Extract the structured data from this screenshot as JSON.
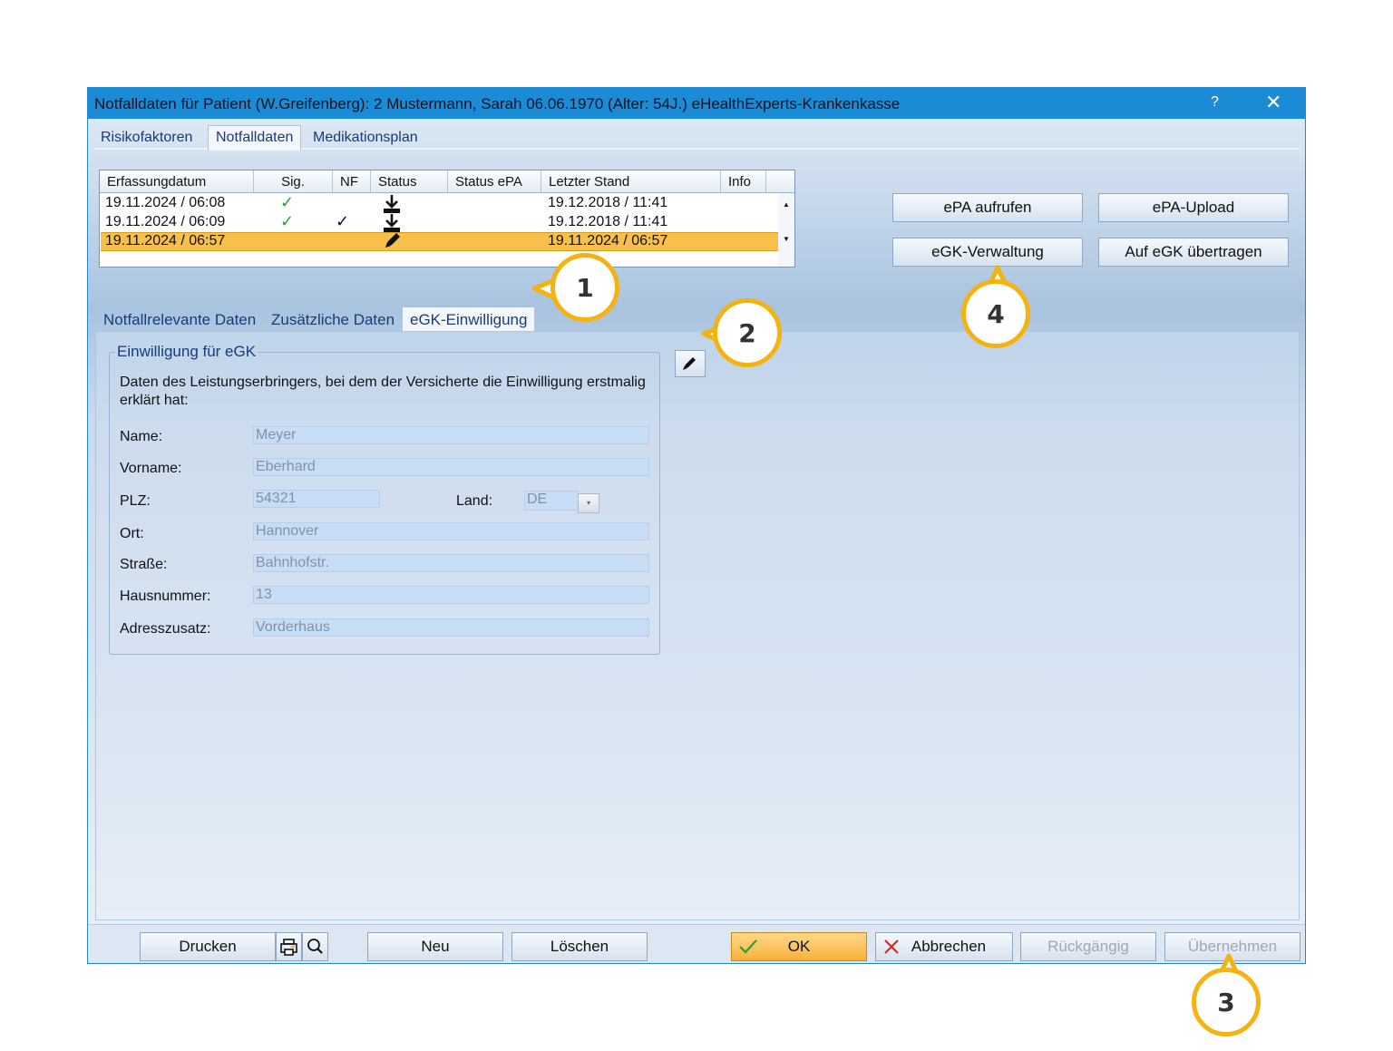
{
  "window": {
    "title": "Notfalldaten für Patient (W.Greifenberg): 2  Mustermann, Sarah 06.06.1970  (Alter: 54J.)  eHealthExperts-Krankenkasse",
    "help_label": "?",
    "close_label": "✕"
  },
  "top_tabs": [
    {
      "label": "Risikofaktoren"
    },
    {
      "label": "Notfalldaten"
    },
    {
      "label": "Medikationsplan"
    }
  ],
  "grid": {
    "columns": [
      "Erfassungdatum",
      "Sig.",
      "NF",
      "Status",
      "Status ePA",
      "Letzter Stand",
      "Info"
    ],
    "rows": [
      {
        "date": "19.11.2024 / 06:08",
        "sig": "✓",
        "nf": "",
        "status_icon": "download-icon",
        "status_epa": "",
        "last": "19.12.2018 / 11:41",
        "info": ""
      },
      {
        "date": "19.11.2024 / 06:09",
        "sig": "✓",
        "nf": "✓",
        "status_icon": "download-icon",
        "status_epa": "",
        "last": "19.12.2018 / 11:41",
        "info": ""
      },
      {
        "date": "19.11.2024 / 06:57",
        "sig": "",
        "nf": "",
        "status_icon": "pencil-icon",
        "status_epa": "",
        "last": "19.11.2024 / 06:57",
        "info": ""
      }
    ],
    "selected_row": 2,
    "selected_color": "#f7c04a"
  },
  "actions": {
    "epa_aufrufen": "ePA aufrufen",
    "epa_upload": "ePA-Upload",
    "egk_verwaltung": "eGK-Verwaltung",
    "auf_egk": "Auf eGK übertragen"
  },
  "sub_tabs": [
    {
      "label": "Notfallrelevante Daten"
    },
    {
      "label": "Zusätzliche Daten"
    },
    {
      "label": "eGK-Einwilligung"
    }
  ],
  "consent": {
    "legend": "Einwilligung für eGK",
    "description": "Daten des Leistungserbringers, bei dem der Versicherte die Einwilligung erstmalig erklärt hat:",
    "fields": {
      "name_label": "Name:",
      "name_value": "Meyer",
      "vorname_label": "Vorname:",
      "vorname_value": "Eberhard",
      "plz_label": "PLZ:",
      "plz_value": "54321",
      "land_label": "Land:",
      "land_value": "DE",
      "ort_label": "Ort:",
      "ort_value": "Hannover",
      "strasse_label": "Straße:",
      "strasse_value": "Bahnhofstr.",
      "hausnummer_label": "Hausnummer:",
      "hausnummer_value": "13",
      "adresszusatz_label": "Adresszusatz:",
      "adresszusatz_value": "Vorderhaus"
    }
  },
  "footer": {
    "drucken": "Drucken",
    "neu": "Neu",
    "loeschen": "Löschen",
    "ok": "OK",
    "abbrechen": "Abbrechen",
    "rueckgaengig": "Rückgängig",
    "uebernehmen": "Übernehmen"
  },
  "callouts": {
    "c1": "1",
    "c2": "2",
    "c3": "3",
    "c4": "4"
  },
  "colors": {
    "accent": "#1b8bd6",
    "callout": "#f4b310",
    "ok": "#f8b23a",
    "check": "#2d9d3a",
    "cancel": "#d9231d"
  }
}
